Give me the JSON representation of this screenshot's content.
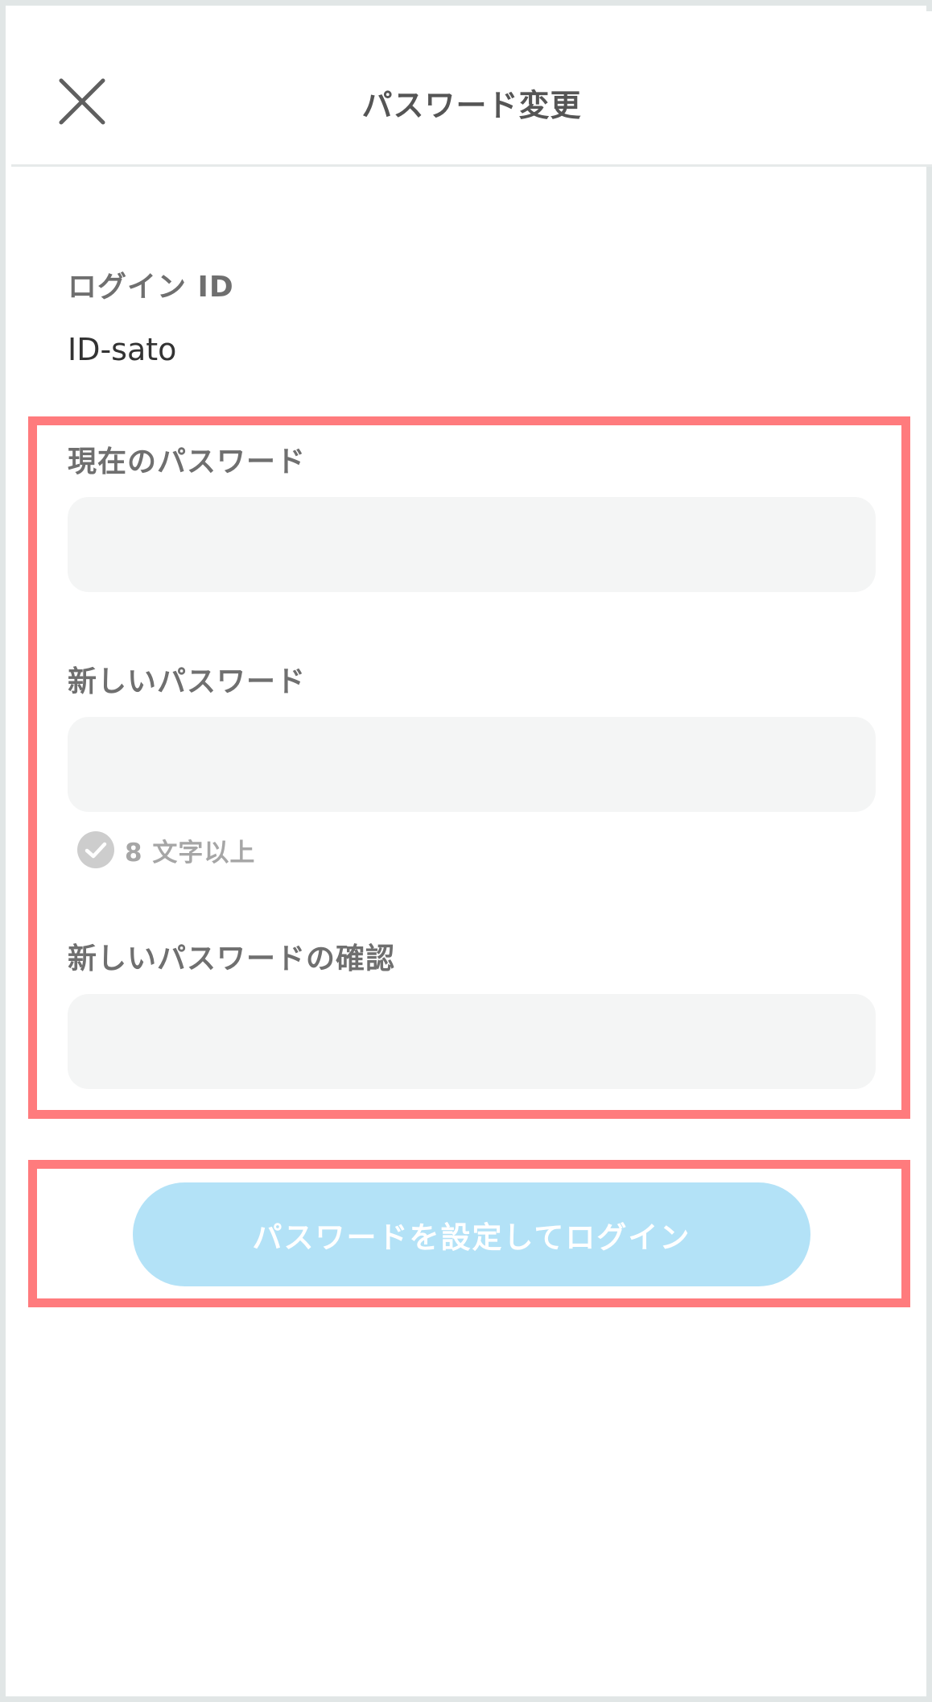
{
  "header": {
    "title": "パスワード変更",
    "close_icon": "close-icon"
  },
  "login_id": {
    "label": "ログイン ID",
    "value": "ID-sato"
  },
  "current_password": {
    "label": "現在のパスワード",
    "value": ""
  },
  "new_password": {
    "label": "新しいパスワード",
    "value": "",
    "hint": {
      "icon": "check-circle-icon",
      "text": "8 文字以上"
    }
  },
  "confirm_password": {
    "label": "新しいパスワードの確認",
    "value": ""
  },
  "submit": {
    "label": "パスワードを設定してログイン"
  },
  "colors": {
    "highlight": "#ff7b7d",
    "button_bg": "#b3e2f7",
    "field_bg": "#f4f5f5",
    "label": "#6f6f6f"
  }
}
